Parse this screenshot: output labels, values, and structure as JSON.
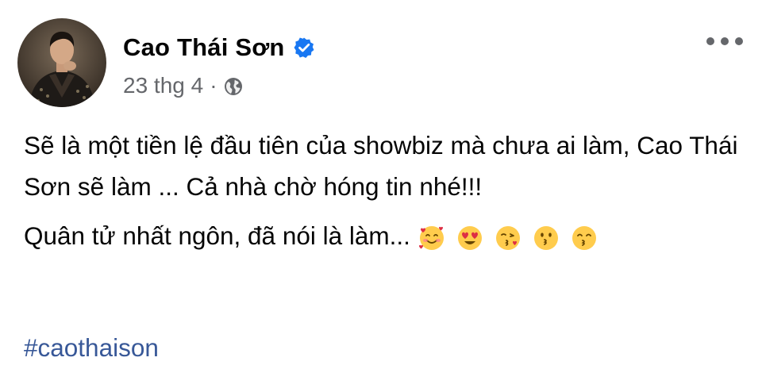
{
  "post": {
    "author": "Cao Thái Sơn",
    "verified": true,
    "date": "23 thg 4",
    "separator": "·",
    "privacy_icon": "globe-icon",
    "more_icon": "more-options-icon",
    "text_paragraph_1": "Sẽ là một tiền lệ đầu tiên của showbiz mà chưa ai làm, Cao Thái Sơn sẽ làm ... Cả nhà chờ hóng tin nhé!!!",
    "text_paragraph_2": "Quân tử nhất ngôn, đã nói là làm...",
    "emojis": [
      "smiling-face-with-hearts",
      "heart-eyes",
      "face-blowing-kiss",
      "kissing-face",
      "kissing-smiling-eyes"
    ],
    "hashtag": "#caothaison"
  },
  "colors": {
    "text": "#050505",
    "meta": "#65676b",
    "verified_badge": "#1877f2",
    "hashtag": "#385898",
    "emoji_yellow": "#ffcc4d"
  }
}
